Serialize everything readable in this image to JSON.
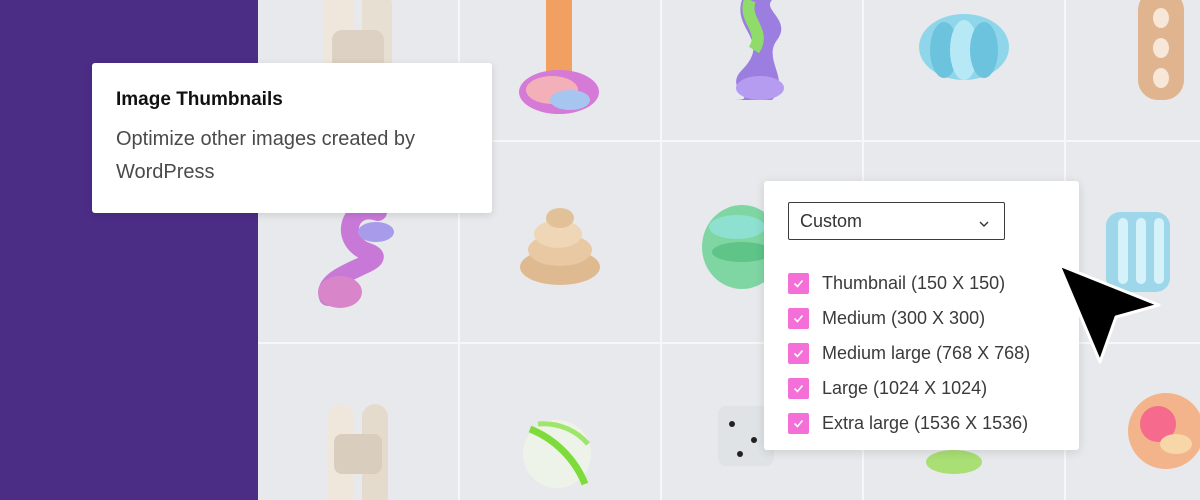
{
  "info_card": {
    "title": "Image Thumbnails",
    "description": "Optimize other images created by WordPress"
  },
  "size_panel": {
    "dropdown": {
      "selected": "Custom"
    },
    "sizes": [
      {
        "label": "Thumbnail (150 X 150)",
        "checked": true
      },
      {
        "label": "Medium (300 X 300)",
        "checked": true
      },
      {
        "label": "Medium large (768 X 768)",
        "checked": true
      },
      {
        "label": "Large (1024 X 1024)",
        "checked": true
      },
      {
        "label": "Extra large (1536 X 1536)",
        "checked": true
      }
    ]
  },
  "colors": {
    "brand_purple": "#4b2d86",
    "checkbox_pink": "#f56fd9",
    "tile_background": "#e7e9ec"
  },
  "icons": {
    "dropdown": "chevron-down-icon",
    "check": "check-icon",
    "cursor": "mouse-pointer-icon"
  }
}
